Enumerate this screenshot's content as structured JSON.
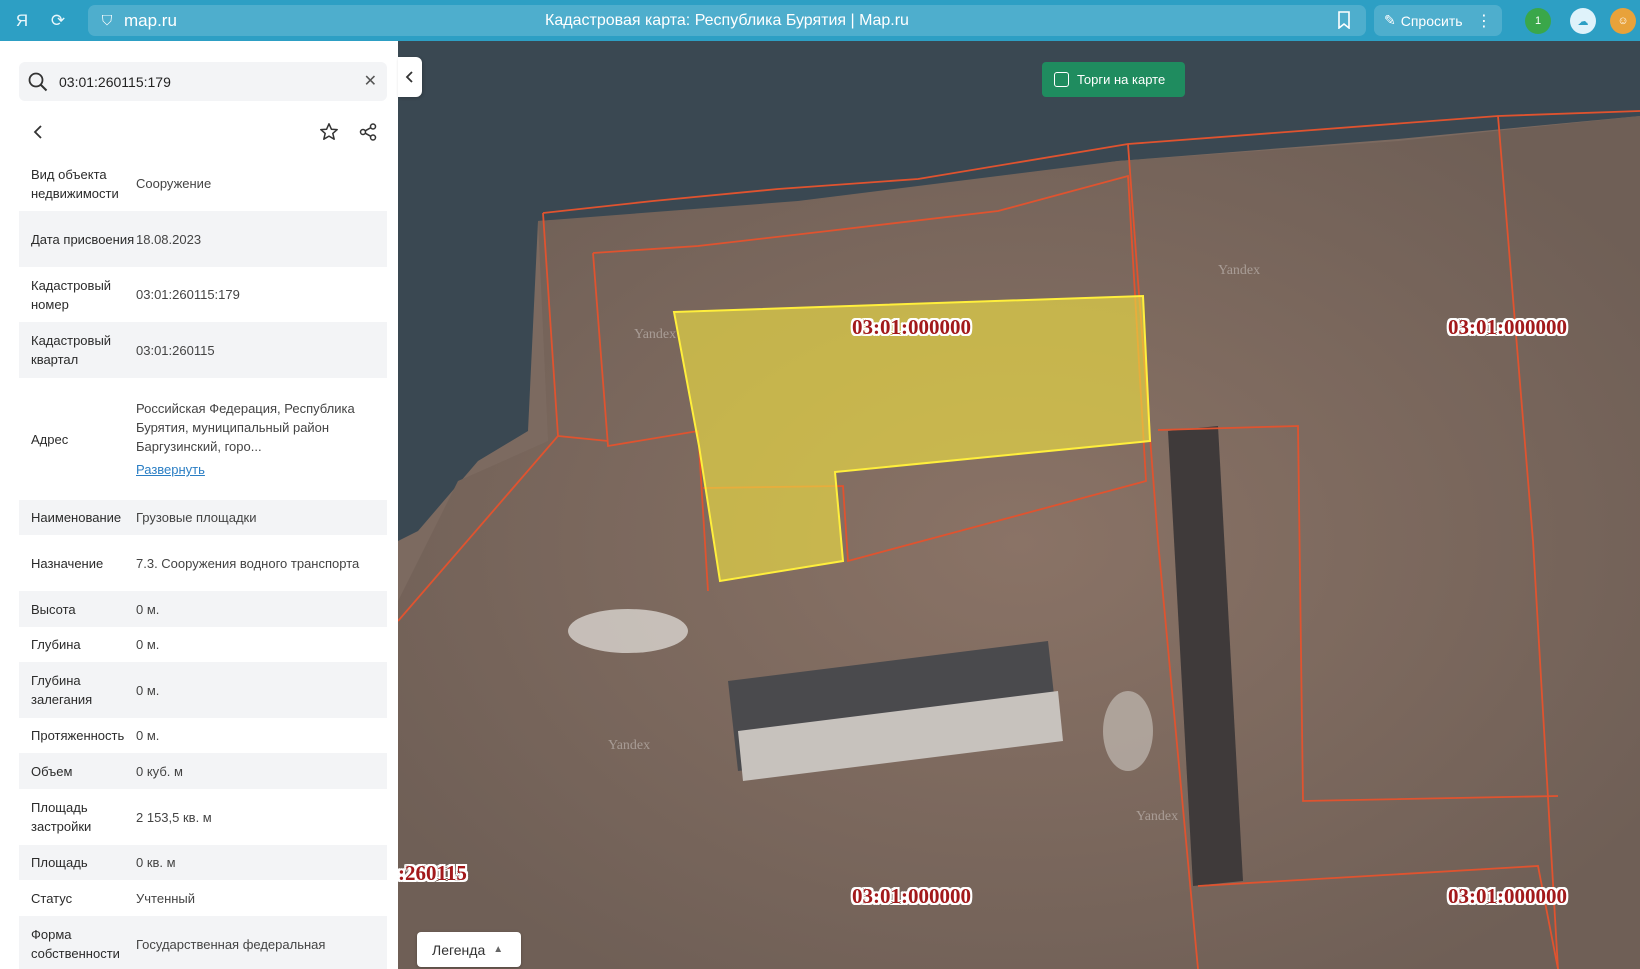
{
  "browser": {
    "domain": "map.ru",
    "title": "Кадастровая карта: Республика Бурятия | Map.ru",
    "ask_label": "Спросить",
    "ext_badge": "1"
  },
  "panel": {
    "search_value": "03:01:260115:179",
    "properties": [
      {
        "key": "Вид объекта недвижимости",
        "value": "Сооружение"
      },
      {
        "key": "Дата присвоения",
        "value": "18.08.2023"
      },
      {
        "key": "Кадастровый номер",
        "value": "03:01:260115:179"
      },
      {
        "key": "Кадастровый квартал",
        "value": "03:01:260115"
      },
      {
        "key": "Адрес",
        "value": "Российская Федерация, Республика Бурятия, муниципальный район Баргузинский, горо...",
        "link": "Развернуть"
      },
      {
        "key": "Наименование",
        "value": "Грузовые площадки"
      },
      {
        "key": "Назначение",
        "value": "7.3. Сооружения водного транспорта"
      },
      {
        "key": "Высота",
        "value": "0 м."
      },
      {
        "key": "Глубина",
        "value": "0 м."
      },
      {
        "key": "Глубина залегания",
        "value": "0 м."
      },
      {
        "key": "Протяженность",
        "value": "0 м."
      },
      {
        "key": "Объем",
        "value": "0 куб. м"
      },
      {
        "key": "Площадь застройки",
        "value": "2 153,5  кв. м"
      },
      {
        "key": "Площадь",
        "value": "0  кв. м"
      },
      {
        "key": "Статус",
        "value": "Учтенный"
      },
      {
        "key": "Форма собственности",
        "value": "Государственная федеральная"
      }
    ]
  },
  "map": {
    "torgi_label": "Торги на карте",
    "legend_label": "Легенда",
    "labels": {
      "center": "03:01:000000",
      "right": "03:01:000000",
      "bottom_center": "03:01:000000",
      "bottom_right": "03:01:000000",
      "bottom_left": ":260115"
    },
    "watermark": "Yandex",
    "colors": {
      "boundary": "#e0532f",
      "selected_fill": "#ecdd43",
      "selected_stroke": "#ffef3c"
    }
  }
}
